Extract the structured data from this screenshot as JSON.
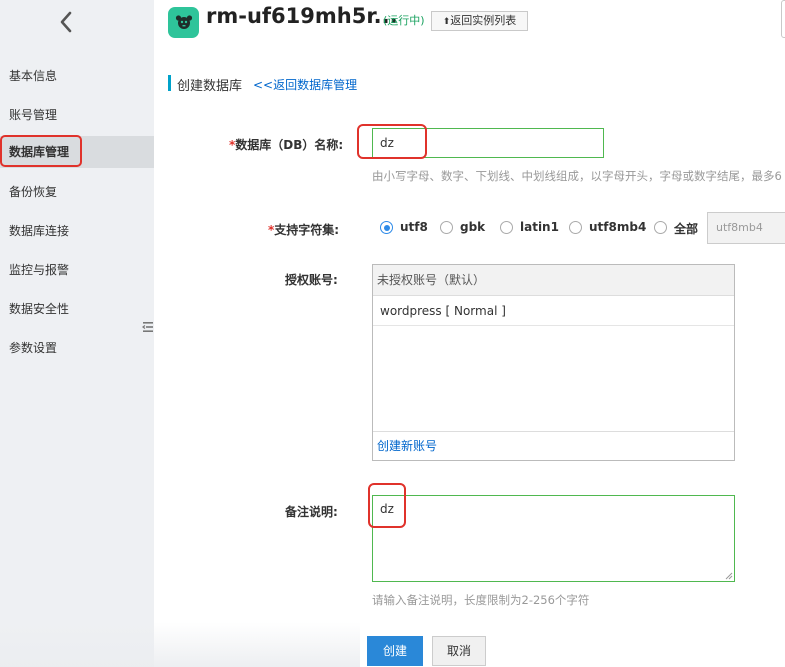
{
  "sidebar": {
    "items": [
      {
        "label": "基本信息"
      },
      {
        "label": "账号管理"
      },
      {
        "label": "数据库管理"
      },
      {
        "label": "备份恢复"
      },
      {
        "label": "数据库连接"
      },
      {
        "label": "监控与报警"
      },
      {
        "label": "数据安全性"
      },
      {
        "label": "参数设置"
      }
    ],
    "active_index": 2,
    "back_icon": "chevron-left-icon",
    "collapse_icon": "collapse-menu-icon"
  },
  "header": {
    "logo_icon": "database-instance-icon",
    "instance_name": "rm-uf619mh5r...",
    "status": "(运行中)",
    "back_button_label": "返回实例列表",
    "back_button_icon": "arrow-up-icon"
  },
  "form": {
    "page_title": "创建数据库",
    "back_link": "<<返回数据库管理",
    "db_name": {
      "label": "数据库（DB）名称:",
      "value": "dz",
      "hint": "由小写字母、数字、下划线、中划线组成，以字母开头，字母或数字结尾，最多6"
    },
    "charset": {
      "label": "支持字符集:",
      "options": [
        "utf8",
        "gbk",
        "latin1",
        "utf8mb4",
        "全部"
      ],
      "selected": "utf8",
      "custom_placeholder": "utf8mb4"
    },
    "accounts": {
      "label": "授权账号:",
      "header": "未授权账号（默认）",
      "items": [
        "wordpress [ Normal ]"
      ],
      "create_link": "创建新账号"
    },
    "remark": {
      "label": "备注说明:",
      "value": "dz",
      "hint": "请输入备注说明，长度限制为2-256个字符"
    },
    "buttons": {
      "create": "创建",
      "cancel": "取消"
    }
  },
  "colors": {
    "accent_blue": "#2a88d8",
    "link_blue": "#0066cc",
    "status_green": "#19a15f",
    "focus_green": "#4fb84f",
    "highlight_red": "#e0322b",
    "logo_green": "#2ec49a"
  }
}
